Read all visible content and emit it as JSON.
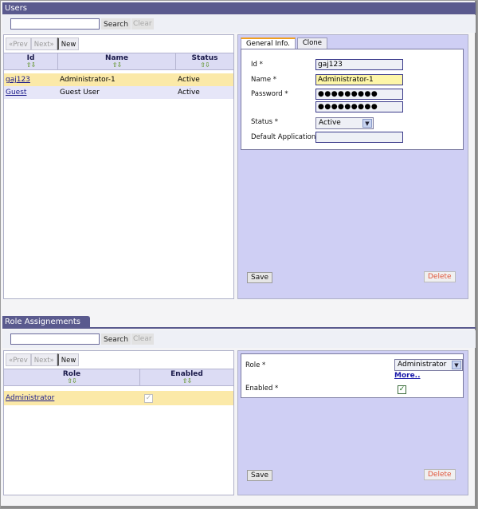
{
  "users": {
    "header": "Users",
    "search": {
      "value": "",
      "button": "Search",
      "clear": "Clear"
    },
    "pager": {
      "prev": "«Prev",
      "next": "Next»",
      "new": "New"
    },
    "columns": [
      "Id",
      "Name",
      "Status"
    ],
    "rows": [
      {
        "id": "gaj123",
        "name": "Administrator-1",
        "status": "Active"
      },
      {
        "id": "Guest",
        "name": "Guest User",
        "status": "Active"
      }
    ],
    "sort_glyph": "⇧⇩",
    "tabs": [
      "General Info.",
      "Clone"
    ],
    "form": {
      "id_label": "Id *",
      "id_value": "gaj123",
      "name_label": "Name *",
      "name_value": "Administrator-1",
      "password_label": "Password *",
      "password_value": "●●●●●●●●●",
      "password_confirm": "●●●●●●●●●",
      "status_label": "Status *",
      "status_value": "Active",
      "default_app_label": "Default Application",
      "default_app_value": ""
    },
    "save": "Save",
    "delete": "Delete"
  },
  "roles": {
    "header": "Role Assignements",
    "search": {
      "value": "",
      "button": "Search",
      "clear": "Clear"
    },
    "pager": {
      "prev": "«Prev",
      "next": "Next»",
      "new": "New"
    },
    "columns": [
      "Role",
      "Enabled"
    ],
    "rows": [
      {
        "role": "Administrator",
        "enabled": true
      }
    ],
    "form": {
      "role_label": "Role *",
      "role_value": "Administrator",
      "more": "More..",
      "enabled_label": "Enabled *",
      "enabled_value": true
    },
    "save": "Save",
    "delete": "Delete",
    "check_glyph": "✓"
  },
  "colors": {
    "header": "#5a5a8e",
    "panel": "#cfcff4",
    "selected_row": "#fbe9a8"
  }
}
